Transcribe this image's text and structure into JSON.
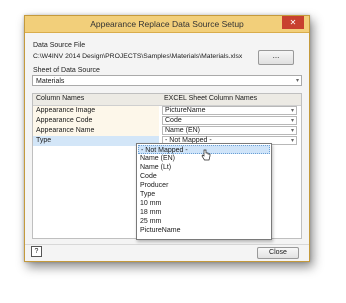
{
  "window": {
    "title": "Appearance Replace Data Source Setup",
    "close_glyph": "✕"
  },
  "data_source_file": {
    "label": "Data Source File",
    "path": "C:\\W4INV 2014 Design\\PROJECTS\\Samples\\Materials\\Materials.xlsx",
    "browse_label": "..."
  },
  "sheet": {
    "label": "Sheet of Data Source",
    "selected": "Materials"
  },
  "grid": {
    "headers": [
      "Column Names",
      "EXCEL Sheet Column Names"
    ],
    "rows": [
      {
        "name": "Appearance Image",
        "value": "PictureName"
      },
      {
        "name": "Appearance Code",
        "value": "Code"
      },
      {
        "name": "Appearance Name",
        "value": "Name (EN)"
      },
      {
        "name": "Type",
        "value": "- Not Mapped -"
      }
    ]
  },
  "dropdown": {
    "options": [
      "- Not Mapped -",
      "Name (EN)",
      "Name (Lt)",
      "Code",
      "Producer",
      "Type",
      "10 mm",
      "18 mm",
      "25 mm",
      "PictureName"
    ],
    "highlighted_index": 0
  },
  "footer": {
    "help_glyph": "?",
    "close_label": "Close"
  },
  "colors": {
    "titlebar": "#f2cf7a",
    "close_button": "#c8412f",
    "selection": "#cfe4f9"
  }
}
